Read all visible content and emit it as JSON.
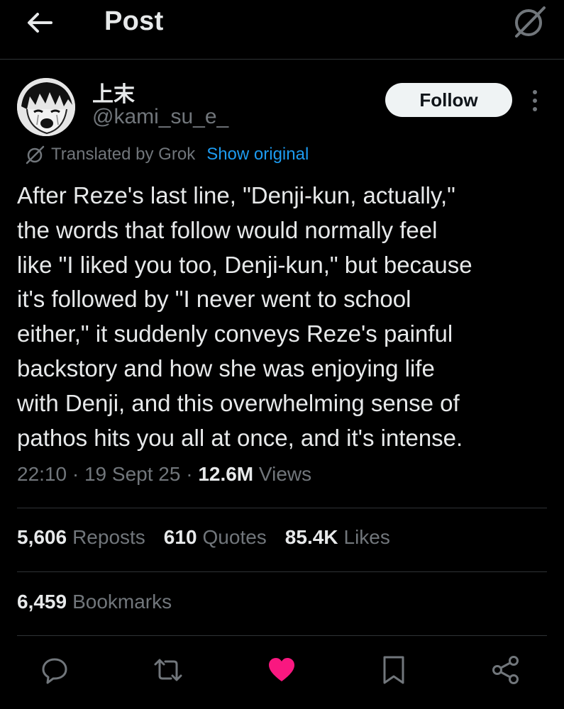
{
  "header": {
    "title": "Post",
    "back_icon": "arrow-left-icon",
    "grok_icon": "grok-icon"
  },
  "author": {
    "display_name": "上末",
    "handle": "@kami_su_e_",
    "follow_label": "Follow"
  },
  "translation": {
    "label": "Translated by Grok",
    "show_original_label": "Show original",
    "link_color": "#1d9bf0"
  },
  "post": {
    "lines": [
      "After Reze's last line, \"Denji-kun, actually,\"",
      "the words that follow would normally feel",
      "like \"I liked you too, Denji-kun,\" but because",
      "it's followed by \"I never went to school",
      "either,\" it suddenly conveys Reze's painful",
      "backstory and how she was enjoying life",
      "with Denji, and this overwhelming sense of",
      "pathos hits you all at once, and it's intense."
    ],
    "time": "22:10",
    "date": "19 Sept 25",
    "views_count": "12.6M",
    "views_label": "Views",
    "separator": "·"
  },
  "stats": {
    "reposts": {
      "count": "5,606",
      "label": "Reposts"
    },
    "quotes": {
      "count": "610",
      "label": "Quotes"
    },
    "likes": {
      "count": "85.4K",
      "label": "Likes"
    },
    "bookmarks": {
      "count": "6,459",
      "label": "Bookmarks"
    }
  },
  "actions": [
    "reply-icon",
    "repost-icon",
    "like-icon",
    "bookmark-icon",
    "share-icon"
  ],
  "colors": {
    "background": "#000000",
    "text": "#e7e9ea",
    "muted": "#71767b",
    "like": "#f91880",
    "divider": "#2f3336"
  }
}
